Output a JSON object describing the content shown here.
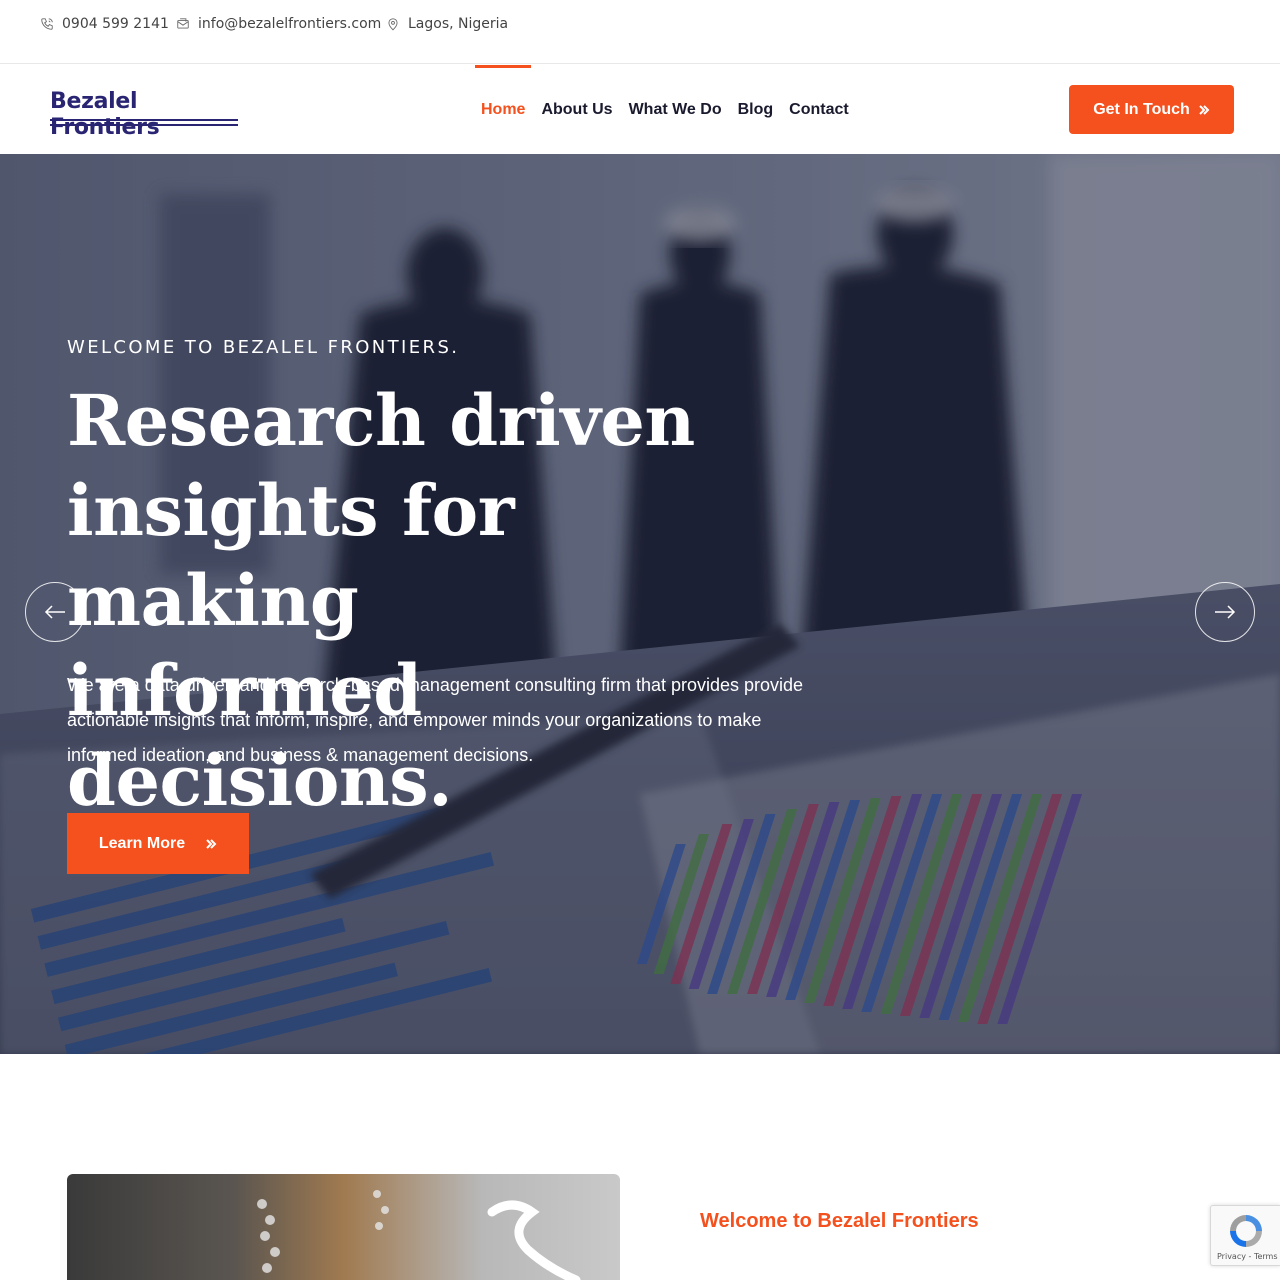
{
  "topbar": {
    "phone": "0904 599 2141",
    "email": "info@bezalelfrontiers.com",
    "location": "Lagos, Nigeria"
  },
  "header": {
    "logo_text": "Bezalel Frontiers",
    "nav": [
      {
        "label": "Home",
        "active": true
      },
      {
        "label": "About Us",
        "active": false
      },
      {
        "label": "What We Do",
        "active": false
      },
      {
        "label": "Blog",
        "active": false
      },
      {
        "label": "Contact",
        "active": false
      }
    ],
    "cta_label": "Get In Touch"
  },
  "hero": {
    "eyebrow": "WELCOME TO BEZALEL FRONTIERS.",
    "headline_line1": "Research driven",
    "headline_line2": "insights for making",
    "headline_line3": "informed decisions.",
    "lead_line1": "We are a data-driven and research-based management consulting firm that provides provide",
    "lead_line2": "actionable insights that inform, inspire, and empower minds your organizations to make",
    "lead_line3": "informed ideation, and business & management decisions.",
    "button_label": "Learn More"
  },
  "about": {
    "title": "Welcome to Bezalel Frontiers"
  },
  "recaptcha": {
    "links": "Privacy - Terms"
  },
  "colors": {
    "accent": "#f4511e",
    "brand": "#2a2573",
    "text": "#1a1a2e"
  },
  "icons": [
    "phone-icon",
    "mail-icon",
    "location-pin-icon",
    "double-chevron-right-icon",
    "arrow-left-icon",
    "arrow-right-icon",
    "recaptcha-icon"
  ]
}
